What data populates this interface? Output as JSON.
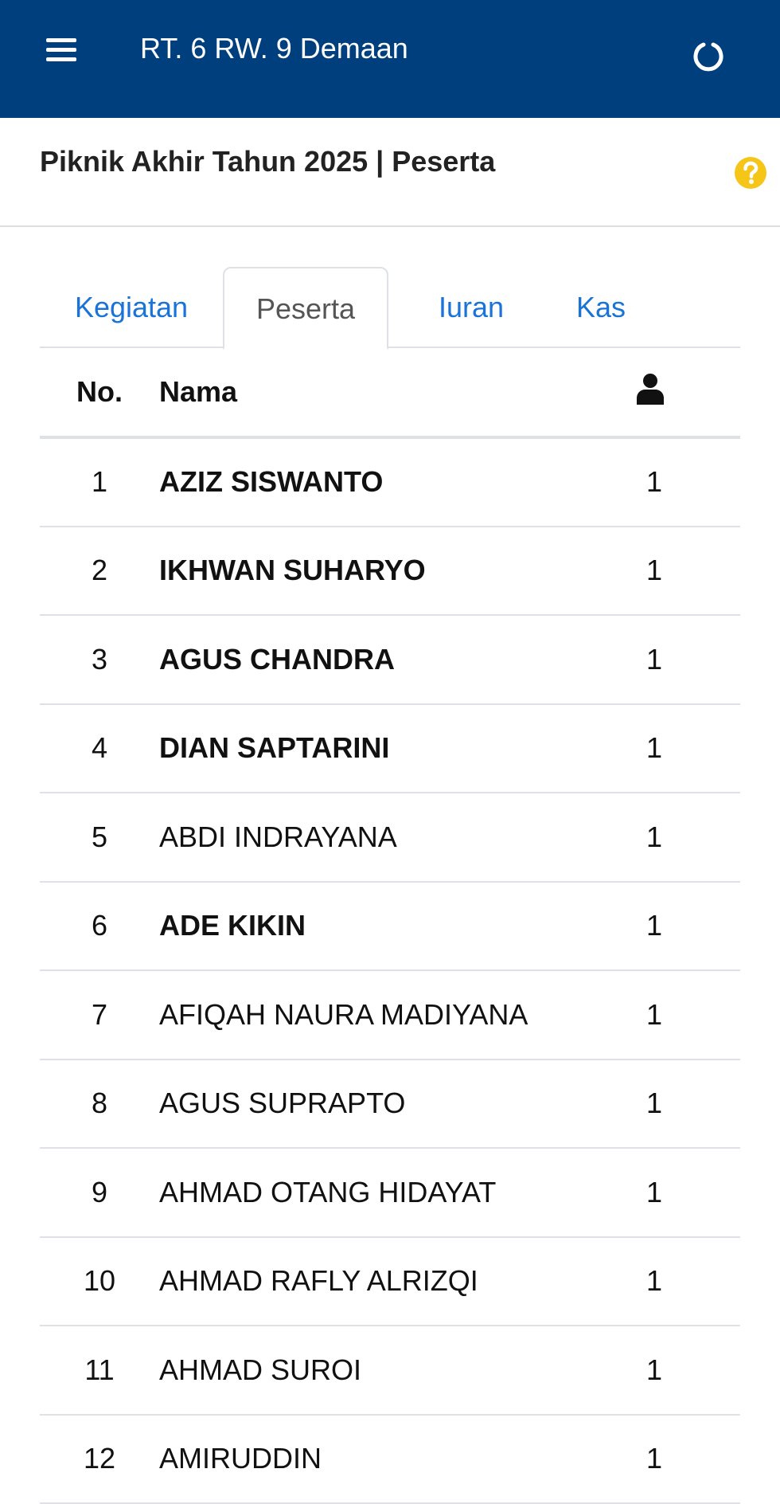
{
  "appbar": {
    "title": "RT. 6 RW. 9 Demaan",
    "bg_color": "#003f7d",
    "menu_icon": "hamburger-menu-icon",
    "refresh_icon": "refresh-icon"
  },
  "header": {
    "title": "Piknik Akhir Tahun 2025 | Peserta",
    "help_icon": "question-circle-icon",
    "help_color": "#f5c518"
  },
  "tabs": [
    {
      "label": "Kegiatan",
      "active": false
    },
    {
      "label": "Peserta",
      "active": true
    },
    {
      "label": "Iuran",
      "active": false
    },
    {
      "label": "Kas",
      "active": false
    }
  ],
  "table": {
    "headers": {
      "no": "No.",
      "nama": "Nama",
      "jumlah_icon": "person-icon"
    },
    "rows": [
      {
        "no": "1",
        "nama": "AZIZ SISWANTO",
        "jumlah": "1",
        "bold": true
      },
      {
        "no": "2",
        "nama": "IKHWAN SUHARYO",
        "jumlah": "1",
        "bold": true
      },
      {
        "no": "3",
        "nama": "AGUS CHANDRA",
        "jumlah": "1",
        "bold": true
      },
      {
        "no": "4",
        "nama": "DIAN SAPTARINI",
        "jumlah": "1",
        "bold": true
      },
      {
        "no": "5",
        "nama": "ABDI INDRAYANA",
        "jumlah": "1",
        "bold": false
      },
      {
        "no": "6",
        "nama": "ADE KIKIN",
        "jumlah": "1",
        "bold": true
      },
      {
        "no": "7",
        "nama": "AFIQAH NAURA MADIYANA",
        "jumlah": "1",
        "bold": false
      },
      {
        "no": "8",
        "nama": "AGUS SUPRAPTO",
        "jumlah": "1",
        "bold": false
      },
      {
        "no": "9",
        "nama": "AHMAD OTANG HIDAYAT",
        "jumlah": "1",
        "bold": false
      },
      {
        "no": "10",
        "nama": "AHMAD RAFLY ALRIZQI",
        "jumlah": "1",
        "bold": false
      },
      {
        "no": "11",
        "nama": "AHMAD SUROI",
        "jumlah": "1",
        "bold": false
      },
      {
        "no": "12",
        "nama": "AMIRUDDIN",
        "jumlah": "1",
        "bold": false
      }
    ]
  }
}
